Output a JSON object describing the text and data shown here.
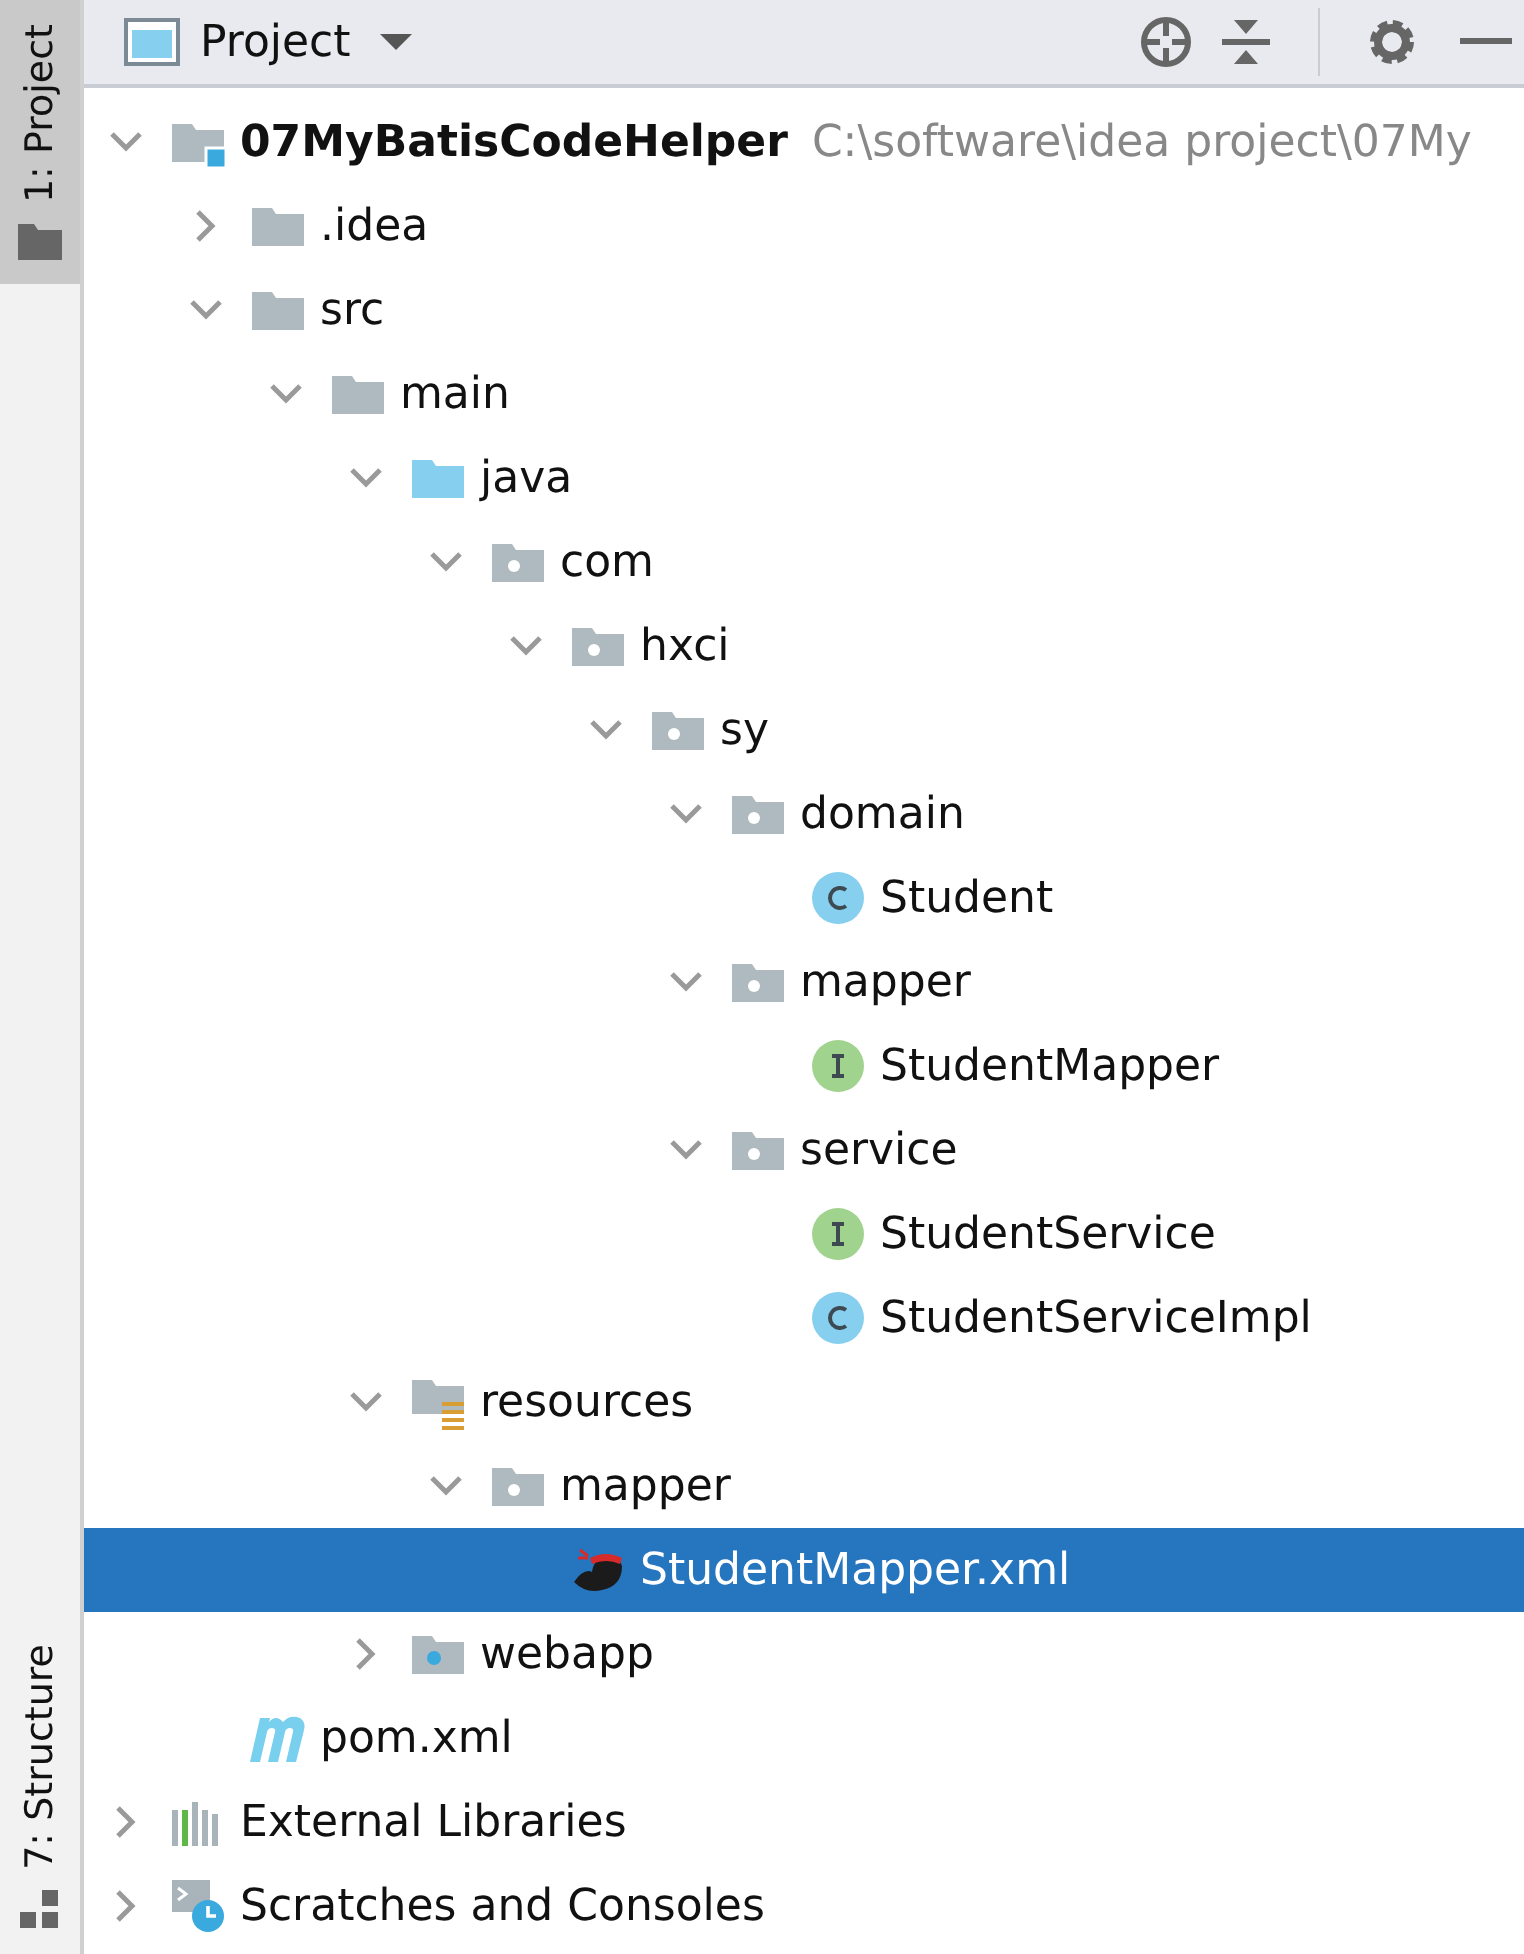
{
  "side_strip": {
    "tabs": [
      {
        "label": "1: Project",
        "selected": true
      },
      {
        "label": "7: Structure",
        "selected": false
      }
    ]
  },
  "toolbar": {
    "title": "Project"
  },
  "tree": [
    {
      "label": "07MyBatisCodeHelper",
      "path": "C:\\software\\idea project\\07My",
      "kind": "module",
      "expanded": true,
      "selected": false,
      "children": [
        {
          "label": ".idea",
          "kind": "folder",
          "expanded": false,
          "selected": false
        },
        {
          "label": "src",
          "kind": "folder",
          "expanded": true,
          "selected": false,
          "children": [
            {
              "label": "main",
              "kind": "folder",
              "expanded": true,
              "selected": false,
              "children": [
                {
                  "label": "java",
                  "kind": "source_folder",
                  "expanded": true,
                  "selected": false,
                  "children": [
                    {
                      "label": "com",
                      "kind": "package",
                      "expanded": true,
                      "selected": false,
                      "children": [
                        {
                          "label": "hxci",
                          "kind": "package",
                          "expanded": true,
                          "selected": false,
                          "children": [
                            {
                              "label": "sy",
                              "kind": "package",
                              "expanded": true,
                              "selected": false,
                              "children": [
                                {
                                  "label": "domain",
                                  "kind": "package",
                                  "expanded": true,
                                  "selected": false,
                                  "children": [
                                    {
                                      "label": "Student",
                                      "kind": "class",
                                      "selected": false
                                    }
                                  ]
                                },
                                {
                                  "label": "mapper",
                                  "kind": "package",
                                  "expanded": true,
                                  "selected": false,
                                  "children": [
                                    {
                                      "label": "StudentMapper",
                                      "kind": "interface",
                                      "selected": false
                                    }
                                  ]
                                },
                                {
                                  "label": "service",
                                  "kind": "package",
                                  "expanded": true,
                                  "selected": false,
                                  "children": [
                                    {
                                      "label": "StudentService",
                                      "kind": "interface",
                                      "selected": false
                                    },
                                    {
                                      "label": "StudentServiceImpl",
                                      "kind": "class",
                                      "selected": false
                                    }
                                  ]
                                }
                              ]
                            }
                          ]
                        }
                      ]
                    }
                  ]
                },
                {
                  "label": "resources",
                  "kind": "resources_folder",
                  "expanded": true,
                  "selected": false,
                  "children": [
                    {
                      "label": "mapper",
                      "kind": "package",
                      "expanded": true,
                      "selected": false,
                      "children": [
                        {
                          "label": "StudentMapper.xml",
                          "kind": "mybatis_xml",
                          "selected": true
                        }
                      ]
                    }
                  ]
                },
                {
                  "label": "webapp",
                  "kind": "web_folder",
                  "expanded": false,
                  "selected": false
                }
              ]
            }
          ]
        },
        {
          "label": "pom.xml",
          "kind": "maven",
          "selected": false
        }
      ]
    },
    {
      "label": "External Libraries",
      "kind": "libraries",
      "expanded": false,
      "selected": false
    },
    {
      "label": "Scratches and Consoles",
      "kind": "scratches",
      "expanded": false,
      "selected": false
    }
  ]
}
